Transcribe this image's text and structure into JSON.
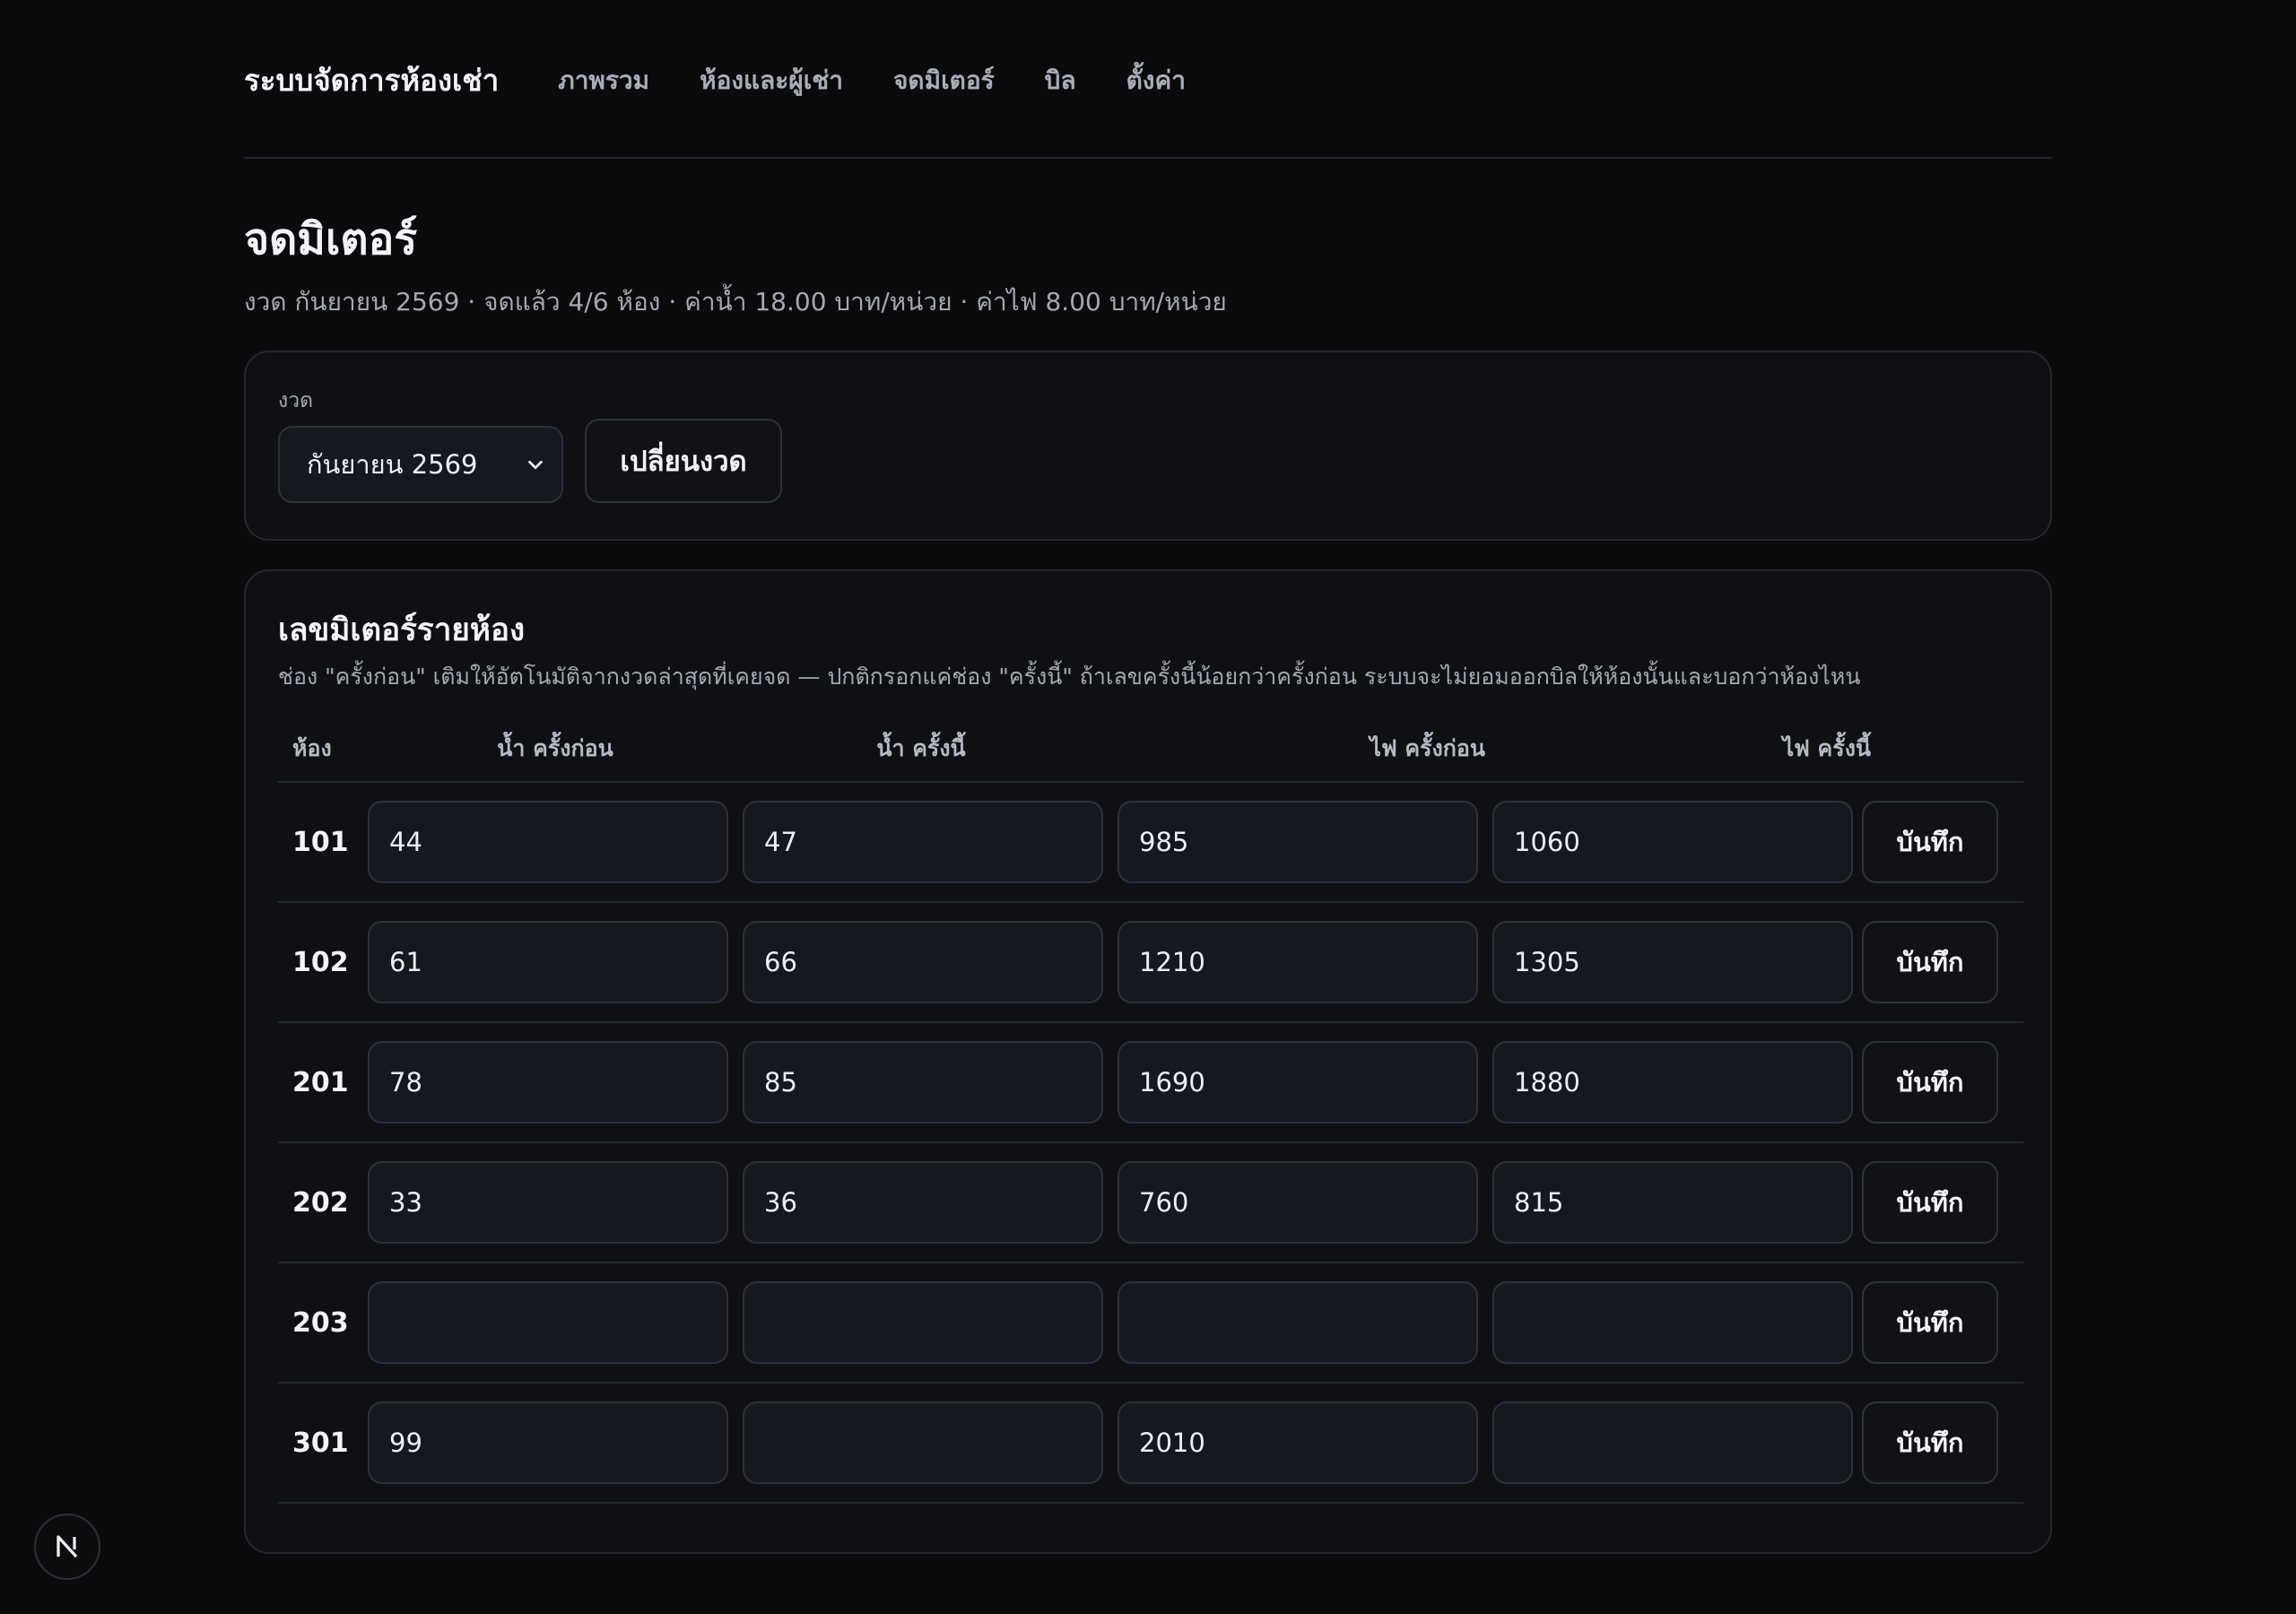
{
  "nav": {
    "brand": "ระบบจัดการห้องเช่า",
    "links": [
      "ภาพรวม",
      "ห้องและผู้เช่า",
      "จดมิเตอร์",
      "บิล",
      "ตั้งค่า"
    ]
  },
  "header": {
    "title": "จดมิเตอร์",
    "subtitle": "งวด กันยายน 2569 · จดแล้ว 4/6 ห้อง · ค่าน้ำ 18.00 บาท/หน่วย · ค่าไฟ 8.00 บาท/หน่วย"
  },
  "period": {
    "label": "งวด",
    "selected": "กันยายน 2569",
    "change_label": "เปลี่ยนงวด"
  },
  "meters": {
    "title": "เลขมิเตอร์รายห้อง",
    "description": "ช่อง \"ครั้งก่อน\" เติมให้อัตโนมัติจากงวดล่าสุดที่เคยจด — ปกติกรอกแค่ช่อง \"ครั้งนี้\" ถ้าเลขครั้งนี้น้อยกว่าครั้งก่อน ระบบจะไม่ยอมออกบิลให้ห้องนั้นและบอกว่าห้องไหน",
    "columns": [
      "ห้อง",
      "น้ำ ครั้งก่อน",
      "น้ำ ครั้งนี้",
      "ไฟ ครั้งก่อน",
      "ไฟ ครั้งนี้"
    ],
    "save_label": "บันทึก",
    "rows": [
      {
        "room": "101",
        "water_prev": "44",
        "water_cur": "47",
        "elec_prev": "985",
        "elec_cur": "1060"
      },
      {
        "room": "102",
        "water_prev": "61",
        "water_cur": "66",
        "elec_prev": "1210",
        "elec_cur": "1305"
      },
      {
        "room": "201",
        "water_prev": "78",
        "water_cur": "85",
        "elec_prev": "1690",
        "elec_cur": "1880"
      },
      {
        "room": "202",
        "water_prev": "33",
        "water_cur": "36",
        "elec_prev": "760",
        "elec_cur": "815"
      },
      {
        "room": "203",
        "water_prev": "",
        "water_cur": "",
        "elec_prev": "",
        "elec_cur": ""
      },
      {
        "room": "301",
        "water_prev": "99",
        "water_cur": "",
        "elec_prev": "2010",
        "elec_cur": ""
      }
    ]
  },
  "badge": {
    "letter": "N",
    "icon": "nextjs-logo-icon"
  }
}
